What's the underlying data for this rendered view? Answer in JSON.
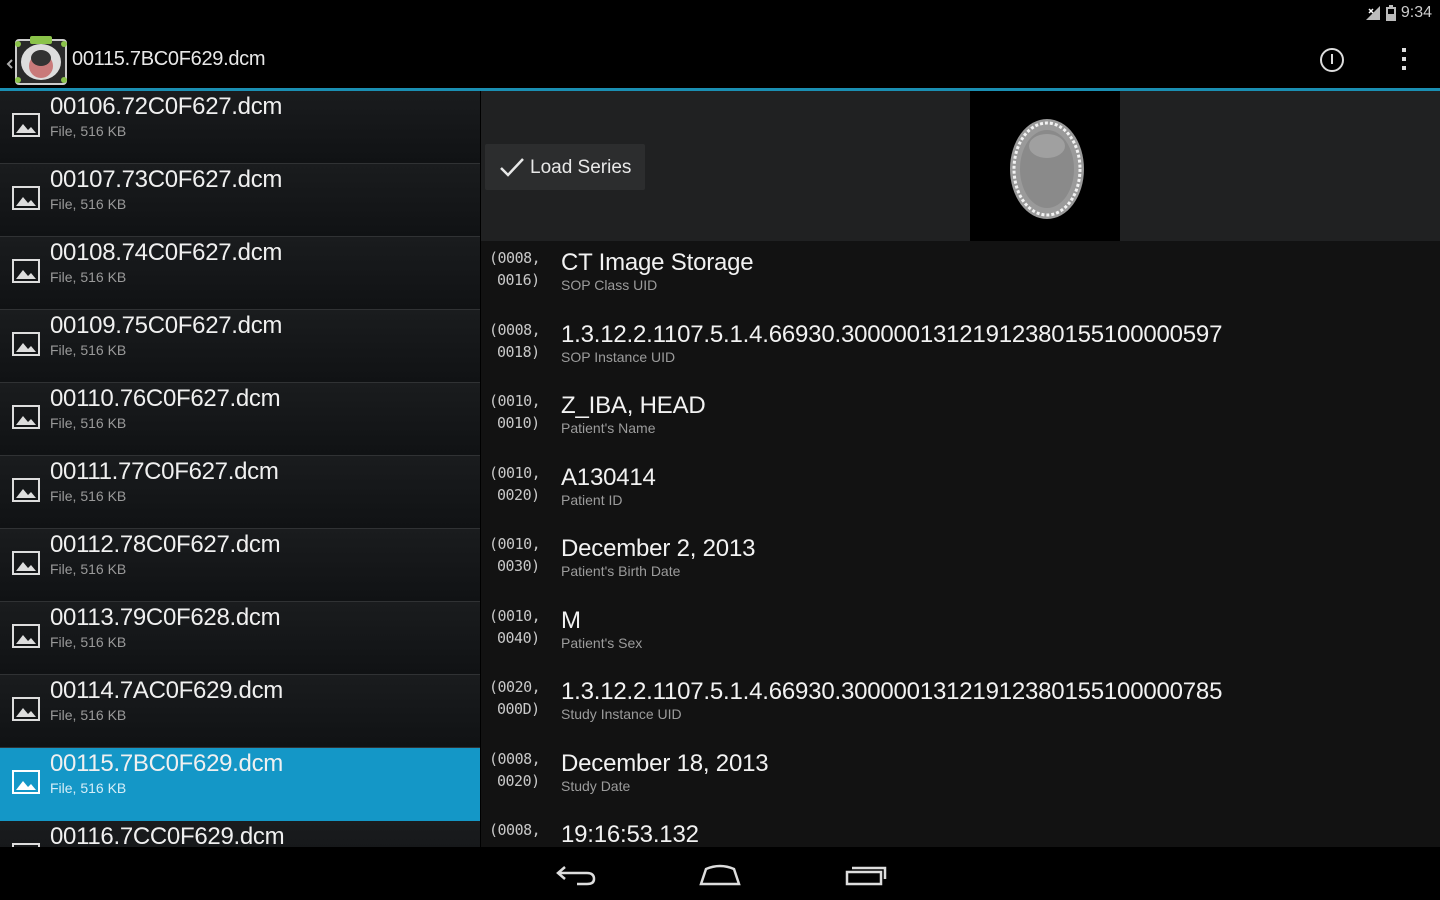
{
  "status_bar": {
    "time": "9:34",
    "icons": [
      "signal-icon",
      "battery-icon"
    ]
  },
  "action_bar": {
    "title": "00115.7BC0F629.dcm",
    "icons": [
      "app-icon",
      "info-icon",
      "overflow-menu-icon"
    ]
  },
  "colors": {
    "accent": "#1a8fb3",
    "selected": "#1497c7",
    "background": "#121212"
  },
  "file_list": {
    "items": [
      {
        "name": "00106.72C0F627.dcm",
        "meta": "File, 516 KB",
        "selected": false
      },
      {
        "name": "00107.73C0F627.dcm",
        "meta": "File, 516 KB",
        "selected": false
      },
      {
        "name": "00108.74C0F627.dcm",
        "meta": "File, 516 KB",
        "selected": false
      },
      {
        "name": "00109.75C0F627.dcm",
        "meta": "File, 516 KB",
        "selected": false
      },
      {
        "name": "00110.76C0F627.dcm",
        "meta": "File, 516 KB",
        "selected": false
      },
      {
        "name": "00111.77C0F627.dcm",
        "meta": "File, 516 KB",
        "selected": false
      },
      {
        "name": "00112.78C0F627.dcm",
        "meta": "File, 516 KB",
        "selected": false
      },
      {
        "name": "00113.79C0F628.dcm",
        "meta": "File, 516 KB",
        "selected": false
      },
      {
        "name": "00114.7AC0F629.dcm",
        "meta": "File, 516 KB",
        "selected": false
      },
      {
        "name": "00115.7BC0F629.dcm",
        "meta": "File, 516 KB",
        "selected": true
      },
      {
        "name": "00116.7CC0F629.dcm",
        "meta": "",
        "selected": false
      }
    ]
  },
  "detail": {
    "load_series_label": "Load Series",
    "tags": [
      {
        "group": "(0008,",
        "element": "0016)",
        "value": "CT Image Storage",
        "description": "SOP Class UID"
      },
      {
        "group": "(0008,",
        "element": "0018)",
        "value": "1.3.12.2.1107.5.1.4.66930.30000013121912380155100000597",
        "description": "SOP Instance UID"
      },
      {
        "group": "(0010,",
        "element": "0010)",
        "value": "Z_IBA, HEAD",
        "description": "Patient's Name"
      },
      {
        "group": "(0010,",
        "element": "0020)",
        "value": "A130414",
        "description": "Patient ID"
      },
      {
        "group": "(0010,",
        "element": "0030)",
        "value": "December 2, 2013",
        "description": "Patient's Birth Date"
      },
      {
        "group": "(0010,",
        "element": "0040)",
        "value": "M",
        "description": "Patient's Sex"
      },
      {
        "group": "(0020,",
        "element": "000D)",
        "value": "1.3.12.2.1107.5.1.4.66930.30000013121912380155100000785",
        "description": "Study Instance UID"
      },
      {
        "group": "(0008,",
        "element": "0020)",
        "value": "December 18, 2013",
        "description": "Study Date"
      },
      {
        "group": "(0008,",
        "element": "",
        "value": "19:16:53.132",
        "description": ""
      }
    ]
  },
  "nav_bar": {
    "icons": [
      "back-icon",
      "home-icon",
      "recents-icon"
    ]
  }
}
